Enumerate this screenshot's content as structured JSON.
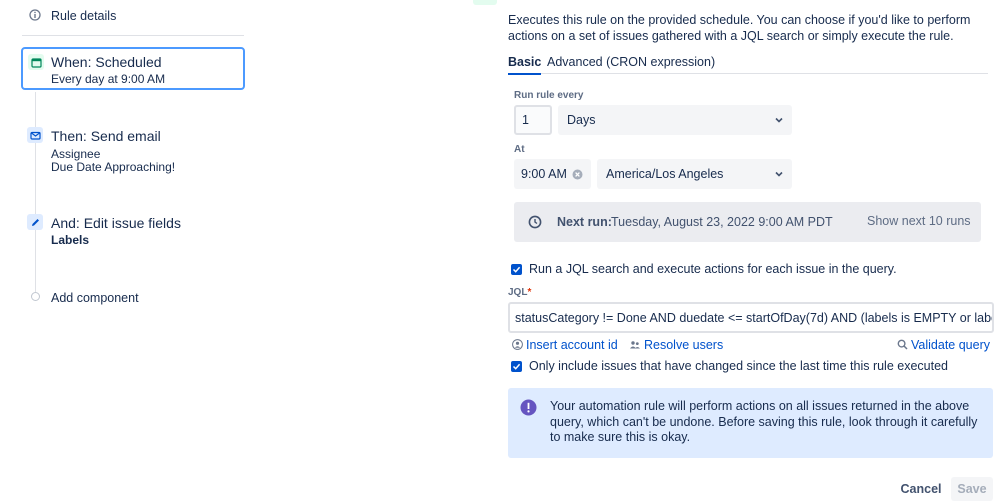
{
  "left": {
    "rule_details": "Rule details",
    "when": {
      "title": "When: Scheduled",
      "subtitle": "Every day at 9:00 AM"
    },
    "then": {
      "title": "Then: Send email",
      "line1": "Assignee",
      "line2": "Due Date Approaching!"
    },
    "and": {
      "title": "And: Edit issue fields",
      "subtitle": "Labels"
    },
    "add_component": "Add component"
  },
  "right": {
    "description": "Executes this rule on the provided schedule. You can choose if you'd like to perform actions on a set of issues gathered with a JQL search or simply execute the rule.",
    "tabs": [
      {
        "label": "Basic",
        "active": true
      },
      {
        "label": "Advanced (CRON expression)",
        "active": false
      }
    ],
    "run_every_label": "Run rule every",
    "interval_value": "1",
    "interval_unit": "Days",
    "at_label": "At",
    "time_value": "9:00 AM",
    "timezone": "America/Los Angeles",
    "next_run_label": "Next run:",
    "next_run_value": "Tuesday, August 23, 2022 9:00 AM PDT",
    "show_next_button": "Show next 10 runs",
    "run_jql_checkbox_label": "Run a JQL search and execute actions for each issue in the query.",
    "jql_label": "JQL",
    "required_mark": "*",
    "jql_value": "statusCategory != Done AND duedate <= startOfDay(7d) AND (labels is EMPTY or labels NOT IN",
    "insert_account_id": "Insert account id",
    "resolve_users": "Resolve users",
    "validate_query": "Validate query",
    "only_include_label": "Only include issues that have changed since the last time this rule executed",
    "warning_text": "Your automation rule will perform actions on all issues returned in the above query, which can't be undone. Before saving this rule, look through it carefully to make sure this is okay.",
    "cancel_button": "Cancel",
    "save_button": "Save"
  },
  "colors": {
    "accent": "#0052cc",
    "focus_border": "#4c9aff",
    "info_bg": "#deebff",
    "warning_icon": "#6554c0",
    "step_green": "#e3fcef",
    "step_blue": "#deebff"
  },
  "icons": {
    "rule_details": "info-circle-icon",
    "when": "calendar-icon",
    "then": "mail-icon",
    "and": "edit-pencil-icon",
    "next_run": "clock-icon",
    "insert_account": "person-icon",
    "resolve_users": "people-icon",
    "validate": "search-icon",
    "warning": "exclamation-icon"
  }
}
